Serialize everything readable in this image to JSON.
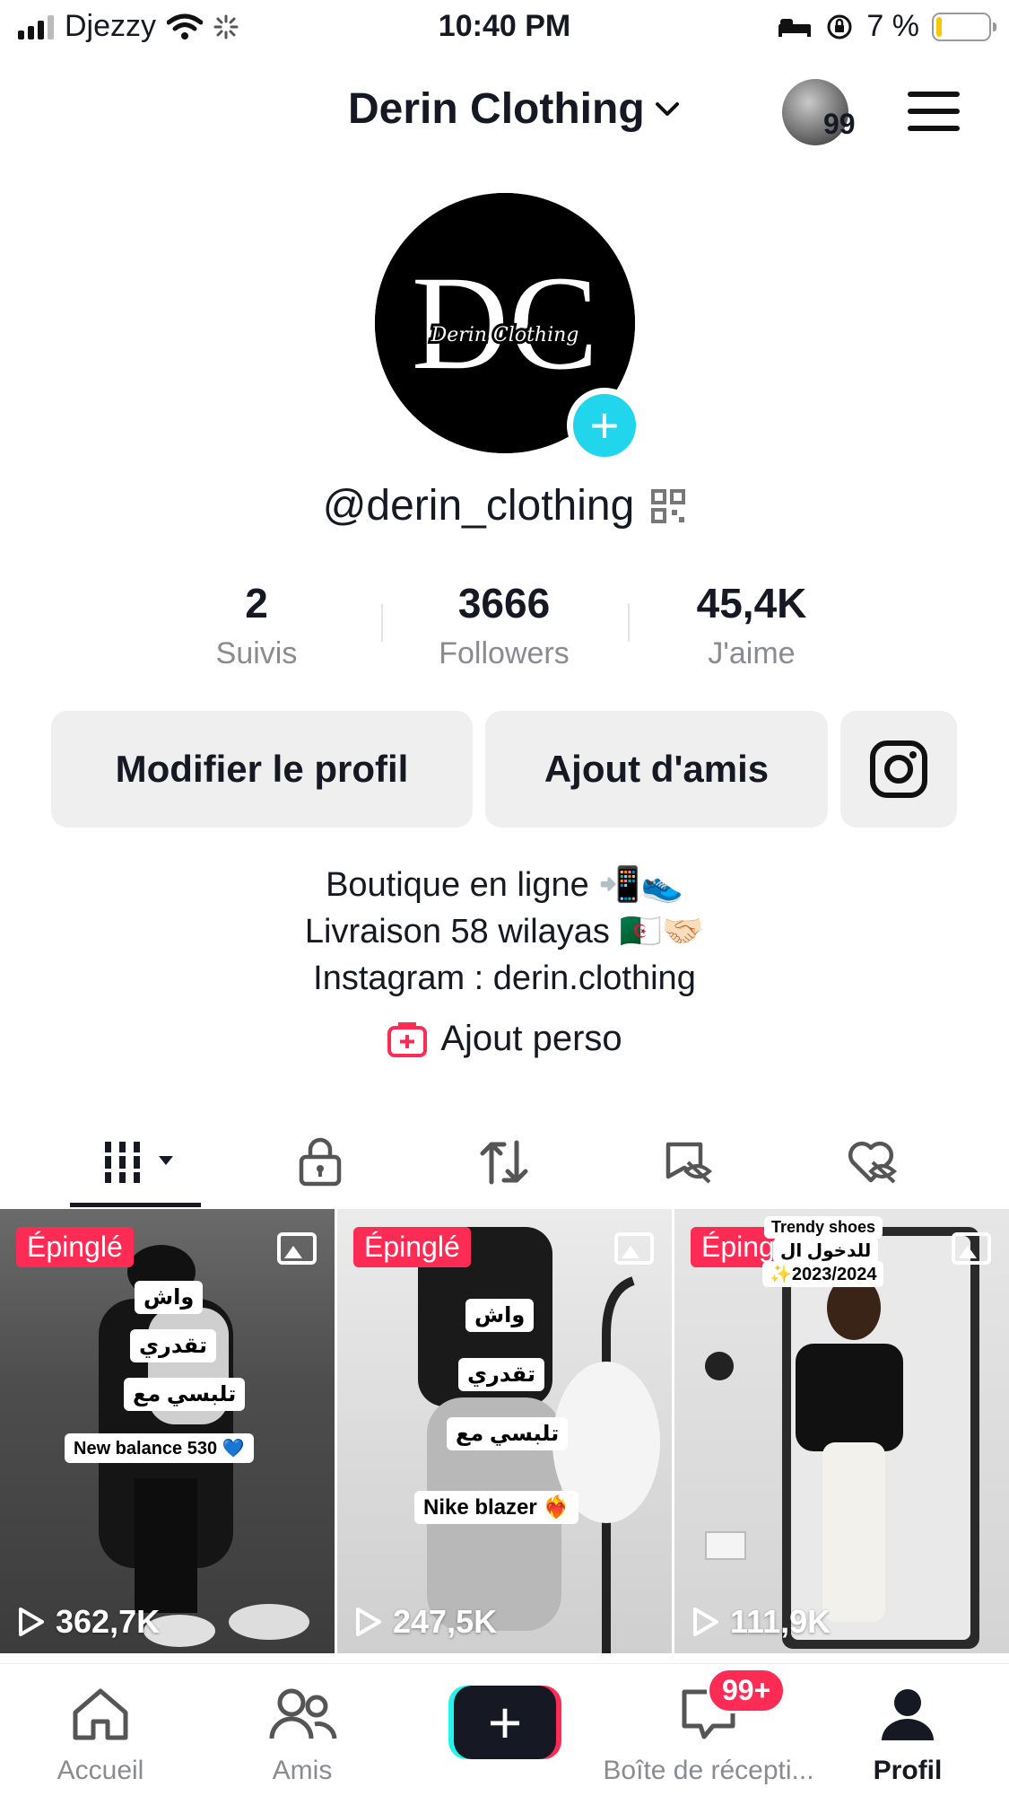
{
  "status_bar": {
    "carrier": "Djezzy",
    "time": "10:40 PM",
    "battery": "7 %",
    "battery_level": 0.07
  },
  "header": {
    "title": "Derin Clothing",
    "notification_count": "99"
  },
  "profile": {
    "avatar_monogram": "DC",
    "avatar_script": "Derin Clothing",
    "username": "@derin_clothing"
  },
  "stats": [
    {
      "value": "2",
      "label": "Suivis"
    },
    {
      "value": "3666",
      "label": "Followers"
    },
    {
      "value": "45,4K",
      "label": "J'aime"
    }
  ],
  "buttons": {
    "edit_profile": "Modifier le profil",
    "add_friends": "Ajout d'amis"
  },
  "bio": {
    "line1": "Boutique en ligne 📲👟",
    "line2": "Livraison 58 wilayas 🇩🇿🤝🏻",
    "line3": "Instagram : derin.clothing"
  },
  "ajout_perso": "Ajout perso",
  "videos": [
    {
      "pinned_label": "Épinglé",
      "views": "362,7K",
      "stickers": [
        "واش",
        "تقدري",
        "تلبسي مع",
        "New balance 530 💙"
      ]
    },
    {
      "pinned_label": "Épinglé",
      "views": "247,5K",
      "stickers": [
        "واش",
        "تقدري",
        "تلبسي مع",
        "Nike blazer ❤️‍🔥"
      ]
    },
    {
      "pinned_label": "Épinglé",
      "views": "111,9K",
      "stickers": [
        "Trendy shoes",
        "للدخول ال",
        "✨2023/2024"
      ]
    }
  ],
  "nav": {
    "home": "Accueil",
    "friends": "Amis",
    "inbox": "Boîte de récepti...",
    "inbox_badge": "99+",
    "profile": "Profil"
  }
}
